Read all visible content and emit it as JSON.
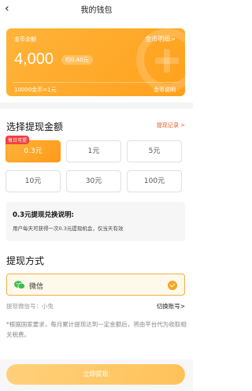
{
  "header": {
    "title": "我的钱包"
  },
  "card": {
    "label": "金币余额",
    "detail_link": "金币明细>",
    "amount": "4,000",
    "approx": "约0.40元",
    "rate": "10000金币=1元",
    "explain_link": "金币说明"
  },
  "withdraw": {
    "title": "选择提现金额",
    "record_link": "提现记录 >",
    "daily_badge": "每日可提",
    "options": [
      "0.3元",
      "1元",
      "5元",
      "10元",
      "30元",
      "100元"
    ],
    "selected_index": 0
  },
  "note": {
    "title": "0.3元提现兑换说明:",
    "text": "用户每天可获得一次0.3元提现机会，仅当天有效"
  },
  "method": {
    "title": "提现方式",
    "option": "微信",
    "account_label": "提现微信号：小兔",
    "switch_link": "切换账号>"
  },
  "disclaimer": "*根据国家要求，每月累计提现达到一定金额后，将由平台代为收取相关税费。",
  "submit": {
    "label": "立即提现"
  },
  "colors": {
    "accent": "#FFA01C",
    "link": "#E0602A",
    "badge": "#F24040"
  }
}
